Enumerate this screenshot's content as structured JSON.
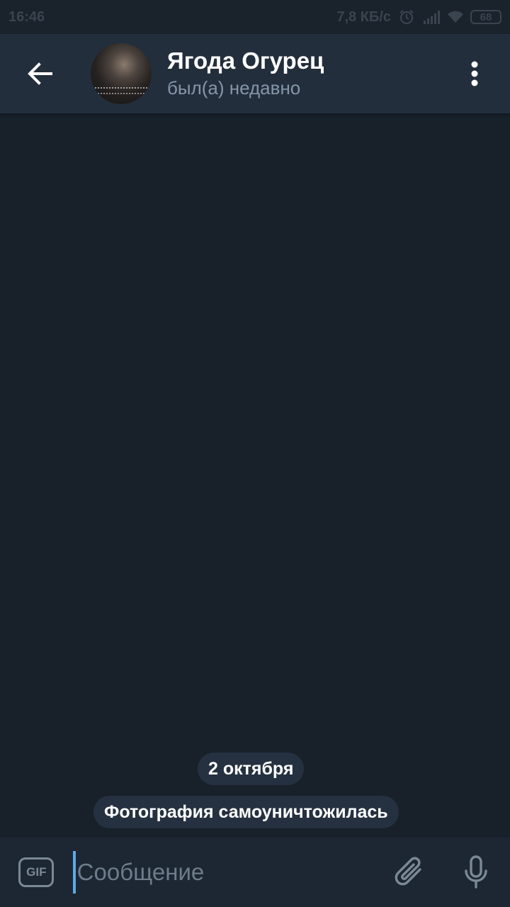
{
  "status_bar": {
    "time": "16:46",
    "speed": "7,8 КБ/с",
    "battery": "68",
    "icons": [
      "alarm-icon",
      "signal-icon",
      "wifi-icon",
      "battery-icon"
    ]
  },
  "header": {
    "contact_name": "Ягода Огурец",
    "contact_status": "был(а) недавно",
    "icons": [
      "back-arrow-icon",
      "more-vert-icon"
    ]
  },
  "chat": {
    "date_label": "2 октября",
    "service_message": "Фотография самоуничтожилась"
  },
  "input_bar": {
    "gif_label": "GIF",
    "placeholder": "Сообщение",
    "value": "",
    "icons": [
      "gif-icon",
      "paperclip-icon",
      "microphone-icon"
    ]
  },
  "colors": {
    "background": "#18202a",
    "header": "#232e3c",
    "pill": "#253140",
    "accent": "#5ea9e6",
    "secondary_text": "#8596a8"
  }
}
